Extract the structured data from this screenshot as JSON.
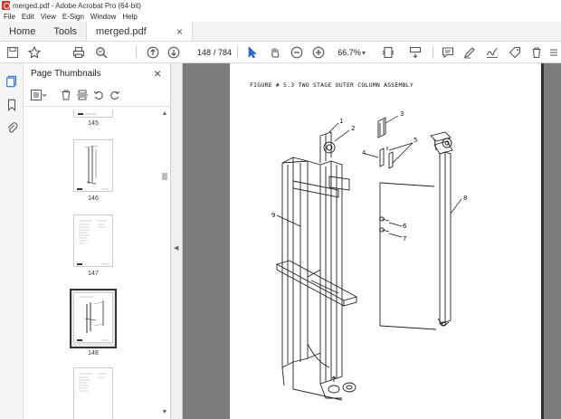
{
  "window": {
    "title": "merged.pdf - Adobe Acrobat Pro (64-bit)"
  },
  "menu": [
    "File",
    "Edit",
    "View",
    "E-Sign",
    "Window",
    "Help"
  ],
  "tabs": {
    "home": "Home",
    "tools": "Tools",
    "document": "merged.pdf",
    "close_glyph": "×"
  },
  "toolbar": {
    "current_page": "148",
    "total_pages": "/ 784",
    "zoom": "66.7%"
  },
  "thumbnails": {
    "panel_title": "Page Thumbnails",
    "close_glyph": "×",
    "pages": [
      {
        "label": "145",
        "selected": false
      },
      {
        "label": "146",
        "selected": false
      },
      {
        "label": "147",
        "selected": false
      },
      {
        "label": "148",
        "selected": true
      },
      {
        "label": "",
        "selected": false
      }
    ]
  },
  "document": {
    "figure_title": "FIGURE # 5.3 TWO STAGE OUTER COLUMN ASSEMBLY",
    "callouts": [
      "1",
      "2",
      "3",
      "4",
      "5",
      "6",
      "7",
      "8",
      "9"
    ]
  },
  "icons": {
    "save": "save-icon",
    "bookmark_star": "star-icon",
    "print": "print-icon",
    "search": "search-icon",
    "prev_page": "arrow-up-circle-icon",
    "next_page": "arrow-down-circle-icon",
    "select": "cursor-icon",
    "hand": "hand-icon",
    "zoom_out": "zoom-out-icon",
    "zoom_in": "zoom-in-icon",
    "fit": "page-fit-icon",
    "scroll": "scroll-mode-icon",
    "comment": "comment-icon",
    "highlight": "pen-icon",
    "sign": "sign-icon",
    "fill": "tag-icon",
    "delete": "trash-icon",
    "more": "more-icon"
  },
  "colors": {
    "acrobat_red": "#d3302b",
    "doc_background": "#7c7c7c"
  }
}
